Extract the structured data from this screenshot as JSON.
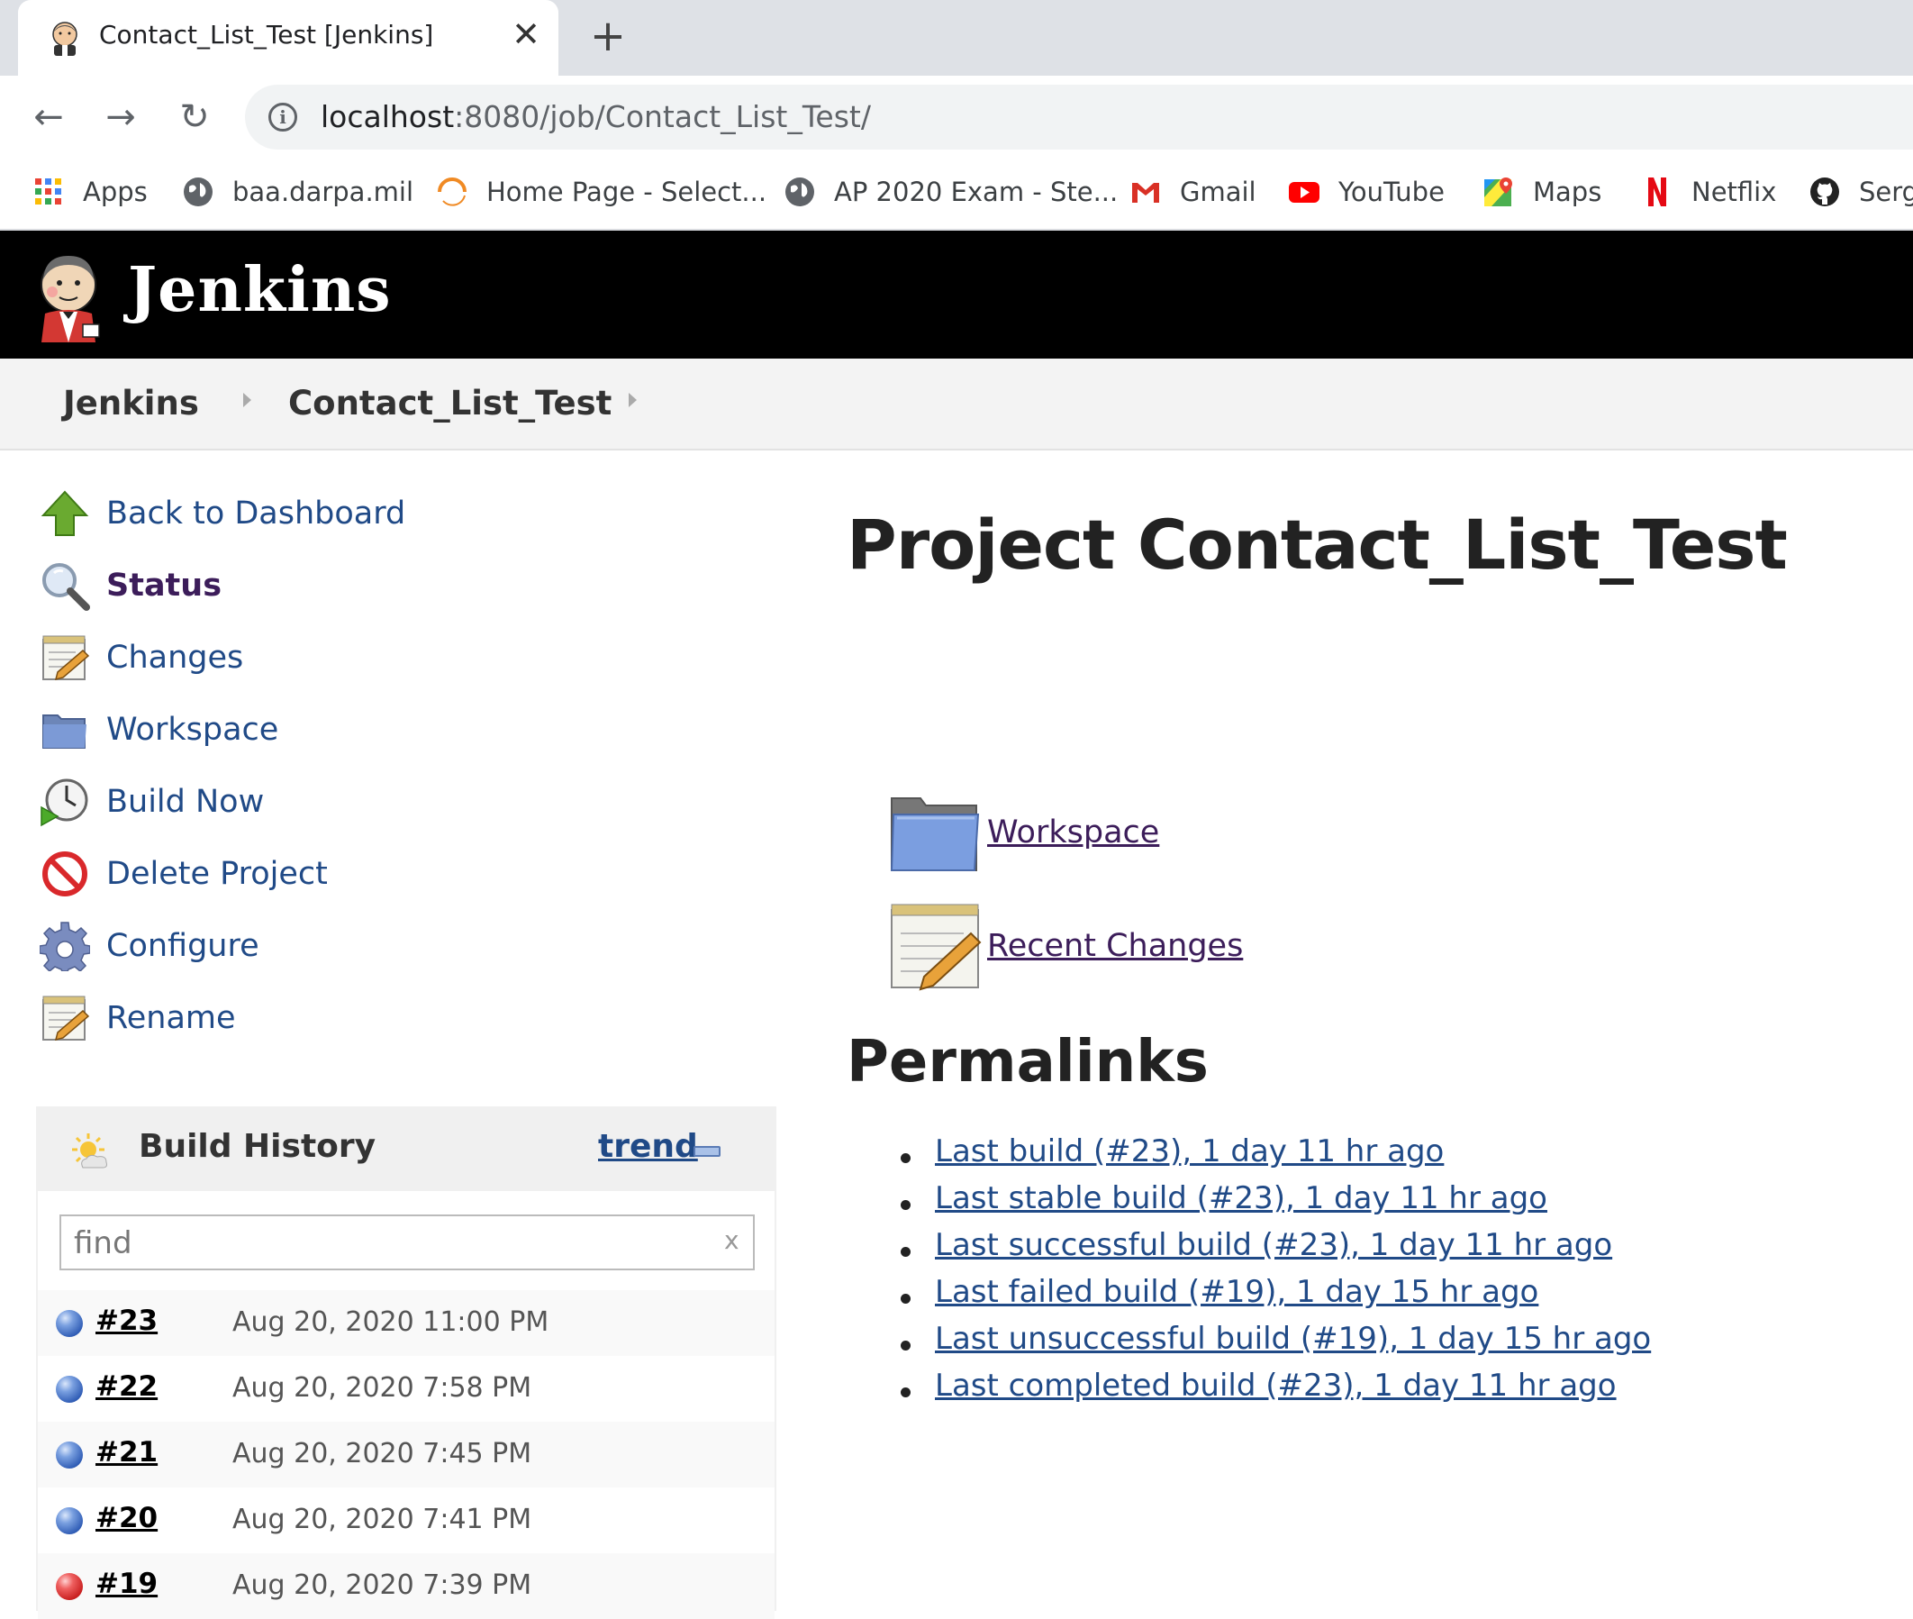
{
  "browser": {
    "tab_title": "Contact_List_Test [Jenkins]",
    "url_host": "localhost",
    "url_rest": ":8080/job/Contact_List_Test/",
    "bookmarks": [
      {
        "label": "Apps",
        "icon": "apps-grid-icon"
      },
      {
        "label": "baa.darpa.mil",
        "icon": "globe-icon"
      },
      {
        "label": "Home Page - Select...",
        "icon": "spinner-icon"
      },
      {
        "label": "AP 2020 Exam - Ste...",
        "icon": "globe-icon"
      },
      {
        "label": "Gmail",
        "icon": "gmail-icon"
      },
      {
        "label": "YouTube",
        "icon": "youtube-icon"
      },
      {
        "label": "Maps",
        "icon": "maps-icon"
      },
      {
        "label": "Netflix",
        "icon": "netflix-icon"
      },
      {
        "label": "Serg",
        "icon": "github-icon"
      }
    ]
  },
  "header": {
    "title": "Jenkins"
  },
  "breadcrumbs": [
    "Jenkins",
    "Contact_List_Test"
  ],
  "sidebar": {
    "tasks": [
      {
        "label": "Back to Dashboard",
        "icon": "up-arrow-icon",
        "bold": false
      },
      {
        "label": "Status",
        "icon": "magnifier-icon",
        "bold": true
      },
      {
        "label": "Changes",
        "icon": "notepad-icon",
        "bold": false
      },
      {
        "label": "Workspace",
        "icon": "folder-icon",
        "bold": false
      },
      {
        "label": "Build Now",
        "icon": "clock-play-icon",
        "bold": false
      },
      {
        "label": "Delete Project",
        "icon": "no-entry-icon",
        "bold": false
      },
      {
        "label": "Configure",
        "icon": "gear-icon",
        "bold": false
      },
      {
        "label": "Rename",
        "icon": "notepad-icon",
        "bold": false
      }
    ]
  },
  "build_history": {
    "title": "Build History",
    "trend_label": "trend",
    "filter_placeholder": "find",
    "clear_label": "x",
    "builds": [
      {
        "number": "#23",
        "date": "Aug 20, 2020 11:00 PM",
        "status": "blue"
      },
      {
        "number": "#22",
        "date": "Aug 20, 2020 7:58 PM",
        "status": "blue"
      },
      {
        "number": "#21",
        "date": "Aug 20, 2020 7:45 PM",
        "status": "blue"
      },
      {
        "number": "#20",
        "date": "Aug 20, 2020 7:41 PM",
        "status": "blue"
      },
      {
        "number": "#19",
        "date": "Aug 20, 2020 7:39 PM",
        "status": "red"
      }
    ]
  },
  "main": {
    "title": "Project Contact_List_Test",
    "links": [
      {
        "label": "Workspace",
        "icon": "folder-icon"
      },
      {
        "label": "Recent Changes",
        "icon": "notepad-icon"
      }
    ],
    "permalinks_title": "Permalinks",
    "permalinks": [
      "Last build (#23), 1 day 11 hr ago",
      "Last stable build (#23), 1 day 11 hr ago",
      "Last successful build (#23), 1 day 11 hr ago",
      "Last failed build (#19), 1 day 15 hr ago",
      "Last unsuccessful build (#19), 1 day 15 hr ago",
      "Last completed build (#23), 1 day 11 hr ago"
    ]
  },
  "colors": {
    "header_bg": "#000000",
    "link": "#204a87",
    "visited_link": "#3c1d5a",
    "success_ball": "#2f5cb5",
    "failure_ball": "#c81e1e"
  }
}
